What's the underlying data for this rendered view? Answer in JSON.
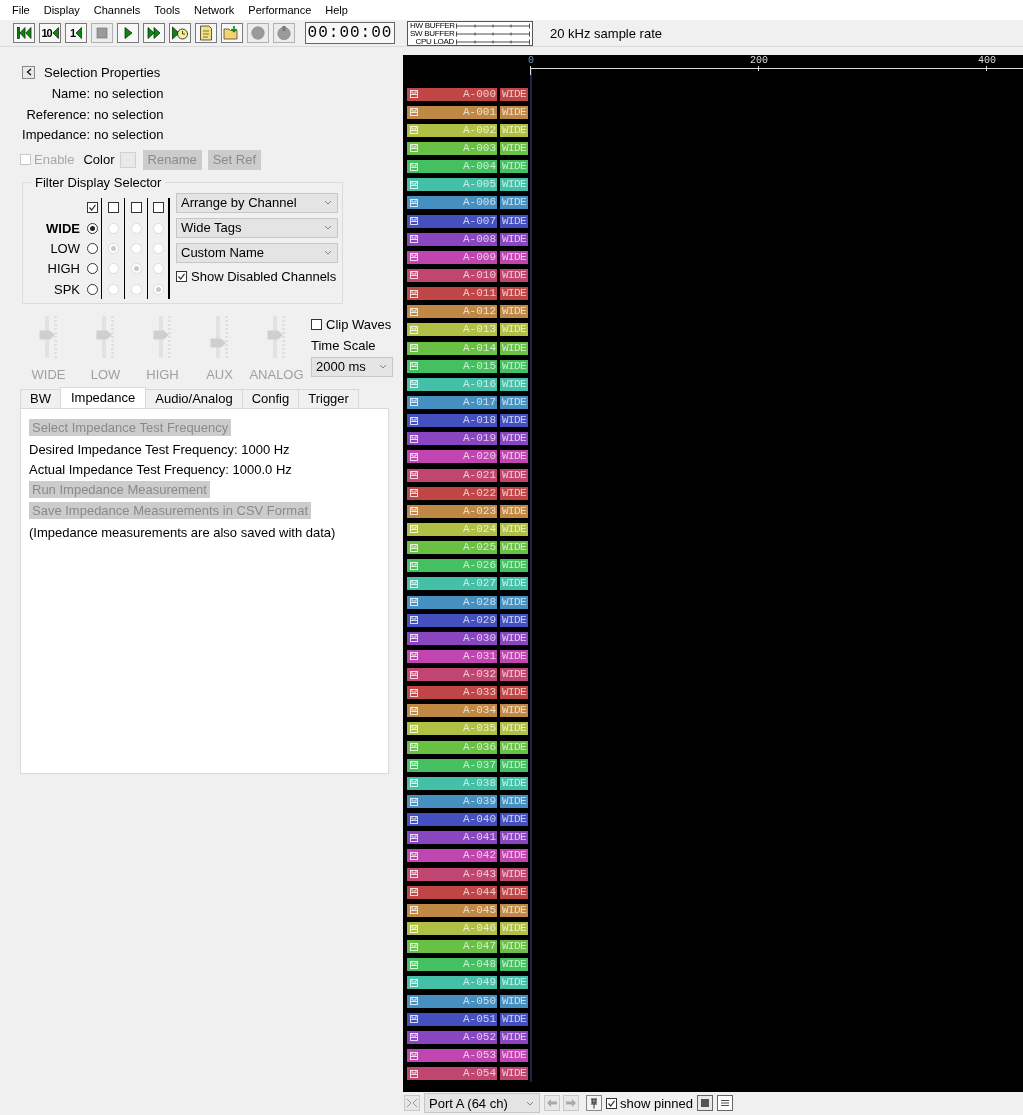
{
  "menu": [
    "File",
    "Display",
    "Channels",
    "Tools",
    "Network",
    "Performance",
    "Help"
  ],
  "toolbar": {
    "buttons": [
      {
        "kind": "skip-start",
        "disabled": false
      },
      {
        "kind": "skip-back",
        "label": "10",
        "disabled": false
      },
      {
        "kind": "skip-back",
        "label": "1",
        "disabled": false
      },
      {
        "kind": "stop",
        "disabled": true
      },
      {
        "kind": "play",
        "disabled": false
      },
      {
        "kind": "fast-forward",
        "disabled": false
      },
      {
        "kind": "timed-run",
        "disabled": false
      },
      {
        "kind": "notes",
        "disabled": false
      },
      {
        "kind": "open-folder",
        "disabled": false
      },
      {
        "kind": "record",
        "disabled": true
      },
      {
        "kind": "triggered-record",
        "disabled": true
      }
    ],
    "timer": "00:00:00",
    "meters": [
      {
        "label": "HW BUFFER"
      },
      {
        "label": "SW BUFFER"
      },
      {
        "label": "CPU LOAD"
      }
    ],
    "sample_rate": "20 kHz sample rate"
  },
  "selection": {
    "title": "Selection Properties",
    "fields": [
      {
        "label": "Name:",
        "value": "no selection"
      },
      {
        "label": "Reference:",
        "value": "no selection"
      },
      {
        "label": "Impedance:",
        "value": "no selection"
      }
    ],
    "enable": {
      "label": "Enable",
      "checked": false,
      "disabled": true
    },
    "color_label": "Color",
    "buttons": [
      {
        "label": "Rename",
        "disabled": true
      },
      {
        "label": "Set Ref",
        "disabled": true
      }
    ]
  },
  "filter": {
    "title": "Filter Display Selector",
    "rows": [
      {
        "label": "WIDE"
      },
      {
        "label": "LOW"
      },
      {
        "label": "HIGH"
      },
      {
        "label": "SPK"
      }
    ],
    "columns": [
      {
        "checked": true,
        "disabled": false,
        "options": [
          {
            "selected": true
          },
          {
            "selected": false
          },
          {
            "selected": false
          },
          {
            "selected": false
          }
        ]
      },
      {
        "checked": false,
        "disabled": true,
        "options": [
          {
            "selected": false
          },
          {
            "selected": true
          },
          {
            "selected": false
          },
          {
            "selected": false
          }
        ]
      },
      {
        "checked": false,
        "disabled": true,
        "options": [
          {
            "selected": false
          },
          {
            "selected": false
          },
          {
            "selected": true
          },
          {
            "selected": false
          }
        ]
      },
      {
        "checked": false,
        "disabled": true,
        "options": [
          {
            "selected": false
          },
          {
            "selected": false
          },
          {
            "selected": false
          },
          {
            "selected": true
          }
        ]
      }
    ],
    "dropdowns": [
      {
        "value": "Arrange by Channel"
      },
      {
        "value": "Wide Tags"
      },
      {
        "value": "Custom Name"
      }
    ],
    "show_disabled": {
      "label": "Show Disabled Channels",
      "checked": true
    }
  },
  "scales": {
    "sliders": [
      {
        "label": "WIDE",
        "level": 0.55,
        "disabled": true
      },
      {
        "label": "LOW",
        "level": 0.55,
        "disabled": true
      },
      {
        "label": "HIGH",
        "level": 0.55,
        "disabled": true
      },
      {
        "label": "AUX",
        "level": 0.3,
        "disabled": true
      },
      {
        "label": "ANALOG",
        "level": 0.55,
        "disabled": true
      }
    ],
    "clip_waves": {
      "label": "Clip Waves",
      "checked": false
    },
    "time_scale_label": "Time Scale",
    "time_scale": "2000 ms"
  },
  "tabs": [
    {
      "label": "BW",
      "selected": false
    },
    {
      "label": "Impedance",
      "selected": true
    },
    {
      "label": "Audio/Analog",
      "selected": false
    },
    {
      "label": "Config",
      "selected": false
    },
    {
      "label": "Trigger",
      "selected": false
    }
  ],
  "impedance_panel": {
    "items": [
      {
        "kind": "button",
        "label": "Select Impedance Test Frequency",
        "disabled": true
      },
      {
        "kind": "text",
        "text": "Desired Impedance Test Frequency: 1000 Hz"
      },
      {
        "kind": "text",
        "text": "Actual Impedance Test Frequency: 1000.0 Hz"
      },
      {
        "kind": "button",
        "label": "Run Impedance Measurement",
        "disabled": true
      },
      {
        "kind": "button",
        "label": "Save Impedance Measurements in CSV Format",
        "disabled": true
      },
      {
        "kind": "text",
        "text": "(Impedance measurements are also saved with data)"
      }
    ]
  },
  "display": {
    "axis_ticks": [
      "0",
      "200",
      "400"
    ],
    "channels": [
      {
        "name": "A-000",
        "tag": "WIDE",
        "color": "#c04545"
      },
      {
        "name": "A-001",
        "tag": "WIDE",
        "color": "#c08845"
      },
      {
        "name": "A-002",
        "tag": "WIDE",
        "color": "#b0c045"
      },
      {
        "name": "A-003",
        "tag": "WIDE",
        "color": "#68c045"
      },
      {
        "name": "A-004",
        "tag": "WIDE",
        "color": "#45c060"
      },
      {
        "name": "A-005",
        "tag": "WIDE",
        "color": "#45c0a8"
      },
      {
        "name": "A-006",
        "tag": "WIDE",
        "color": "#4590c0"
      },
      {
        "name": "A-007",
        "tag": "WIDE",
        "color": "#4550c0"
      },
      {
        "name": "A-008",
        "tag": "WIDE",
        "color": "#8a45c0"
      },
      {
        "name": "A-009",
        "tag": "WIDE",
        "color": "#c045b0"
      },
      {
        "name": "A-010",
        "tag": "WIDE",
        "color": "#c04570"
      },
      {
        "name": "A-011",
        "tag": "WIDE",
        "color": "#c04545"
      },
      {
        "name": "A-012",
        "tag": "WIDE",
        "color": "#c08845"
      },
      {
        "name": "A-013",
        "tag": "WIDE",
        "color": "#b0c045"
      },
      {
        "name": "A-014",
        "tag": "WIDE",
        "color": "#68c045"
      },
      {
        "name": "A-015",
        "tag": "WIDE",
        "color": "#45c060"
      },
      {
        "name": "A-016",
        "tag": "WIDE",
        "color": "#45c0a8"
      },
      {
        "name": "A-017",
        "tag": "WIDE",
        "color": "#4590c0"
      },
      {
        "name": "A-018",
        "tag": "WIDE",
        "color": "#4550c0"
      },
      {
        "name": "A-019",
        "tag": "WIDE",
        "color": "#8a45c0"
      },
      {
        "name": "A-020",
        "tag": "WIDE",
        "color": "#c045b0"
      },
      {
        "name": "A-021",
        "tag": "WIDE",
        "color": "#c04570"
      },
      {
        "name": "A-022",
        "tag": "WIDE",
        "color": "#c04545"
      },
      {
        "name": "A-023",
        "tag": "WIDE",
        "color": "#c08845"
      },
      {
        "name": "A-024",
        "tag": "WIDE",
        "color": "#b0c045"
      },
      {
        "name": "A-025",
        "tag": "WIDE",
        "color": "#68c045"
      },
      {
        "name": "A-026",
        "tag": "WIDE",
        "color": "#45c060"
      },
      {
        "name": "A-027",
        "tag": "WIDE",
        "color": "#45c0a8"
      },
      {
        "name": "A-028",
        "tag": "WIDE",
        "color": "#4590c0"
      },
      {
        "name": "A-029",
        "tag": "WIDE",
        "color": "#4550c0"
      },
      {
        "name": "A-030",
        "tag": "WIDE",
        "color": "#8a45c0"
      },
      {
        "name": "A-031",
        "tag": "WIDE",
        "color": "#c045b0"
      },
      {
        "name": "A-032",
        "tag": "WIDE",
        "color": "#c04570"
      },
      {
        "name": "A-033",
        "tag": "WIDE",
        "color": "#c04545"
      },
      {
        "name": "A-034",
        "tag": "WIDE",
        "color": "#c08845"
      },
      {
        "name": "A-035",
        "tag": "WIDE",
        "color": "#b0c045"
      },
      {
        "name": "A-036",
        "tag": "WIDE",
        "color": "#68c045"
      },
      {
        "name": "A-037",
        "tag": "WIDE",
        "color": "#45c060"
      },
      {
        "name": "A-038",
        "tag": "WIDE",
        "color": "#45c0a8"
      },
      {
        "name": "A-039",
        "tag": "WIDE",
        "color": "#4590c0"
      },
      {
        "name": "A-040",
        "tag": "WIDE",
        "color": "#4550c0"
      },
      {
        "name": "A-041",
        "tag": "WIDE",
        "color": "#8a45c0"
      },
      {
        "name": "A-042",
        "tag": "WIDE",
        "color": "#c045b0"
      },
      {
        "name": "A-043",
        "tag": "WIDE",
        "color": "#c04570"
      },
      {
        "name": "A-044",
        "tag": "WIDE",
        "color": "#c04545"
      },
      {
        "name": "A-045",
        "tag": "WIDE",
        "color": "#c08845"
      },
      {
        "name": "A-046",
        "tag": "WIDE",
        "color": "#b0c045"
      },
      {
        "name": "A-047",
        "tag": "WIDE",
        "color": "#68c045"
      },
      {
        "name": "A-048",
        "tag": "WIDE",
        "color": "#45c060"
      },
      {
        "name": "A-049",
        "tag": "WIDE",
        "color": "#45c0a8"
      },
      {
        "name": "A-050",
        "tag": "WIDE",
        "color": "#4590c0"
      },
      {
        "name": "A-051",
        "tag": "WIDE",
        "color": "#4550c0"
      },
      {
        "name": "A-052",
        "tag": "WIDE",
        "color": "#8a45c0"
      },
      {
        "name": "A-053",
        "tag": "WIDE",
        "color": "#c045b0"
      },
      {
        "name": "A-054",
        "tag": "WIDE",
        "color": "#c04570"
      }
    ]
  },
  "bottom_bar": {
    "port": "Port A (64 ch)",
    "show_pinned": {
      "label": "show pinned",
      "checked": true
    }
  }
}
